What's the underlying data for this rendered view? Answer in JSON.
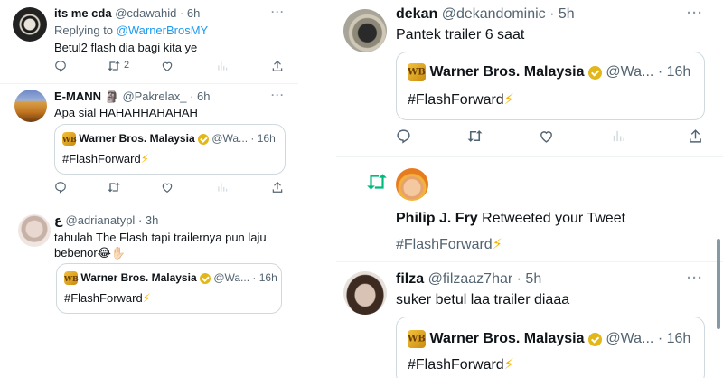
{
  "left": {
    "tweets": [
      {
        "name": "its me cda",
        "handle": "@cdawahid",
        "time": "· 6h",
        "replying_prefix": "Replying to ",
        "replying_to": "@WarnerBrosMY",
        "text": "Betul2 flash dia bagi kita ye",
        "retweets": "2"
      },
      {
        "name": "E-MANN",
        "name_emoji": "🗿",
        "handle": "@Pakrelax_",
        "time": "· 6h",
        "text": "Apa sial HAHAHHAHAHAH",
        "quote": {
          "name": "Warner Bros. Malaysia",
          "handle": "@Wa...",
          "time": "· 16h",
          "text": "#FlashForward",
          "emoji": "⚡"
        }
      },
      {
        "name": "ع",
        "handle": "@adrianatypl",
        "time": "· 3h",
        "text_line1": "tahulah The Flash tapi trailernya pun laju",
        "text_line2": "bebenor😂✋🏻",
        "quote": {
          "name": "Warner Bros. Malaysia",
          "handle": "@Wa...",
          "time": "· 16h",
          "text": "#FlashForward",
          "emoji": "⚡"
        }
      }
    ]
  },
  "right": {
    "tweet1": {
      "name": "dekan",
      "handle": "@dekandominic",
      "time": "· 5h",
      "text": "Pantek trailer 6 saat",
      "quote": {
        "name": "Warner Bros. Malaysia",
        "handle": "@Wa...",
        "time": "· 16h",
        "text": "#FlashForward",
        "emoji": "⚡"
      }
    },
    "retweet_notice": {
      "name": "Philip J. Fry",
      "action": " Retweeted your Tweet",
      "text": "#FlashForward",
      "emoji": "⚡"
    },
    "tweet2": {
      "name": "filza",
      "handle": "@filzaaz7har",
      "time": "· 5h",
      "text": "suker betul laa trailer diaaa",
      "quote": {
        "name": "Warner Bros. Malaysia",
        "handle": "@Wa...",
        "time": "· 16h",
        "text": "#FlashForward",
        "emoji": "⚡"
      }
    }
  },
  "icons": {
    "more": "more-icon",
    "reply": "reply-icon",
    "retweet": "retweet-icon",
    "like": "like-icon",
    "views": "views-icon",
    "share": "share-icon"
  },
  "colors": {
    "link": "#1d9bf0",
    "retweet_green": "#00ba7c",
    "verified_gold": "#e2b719",
    "muted": "#536471"
  }
}
